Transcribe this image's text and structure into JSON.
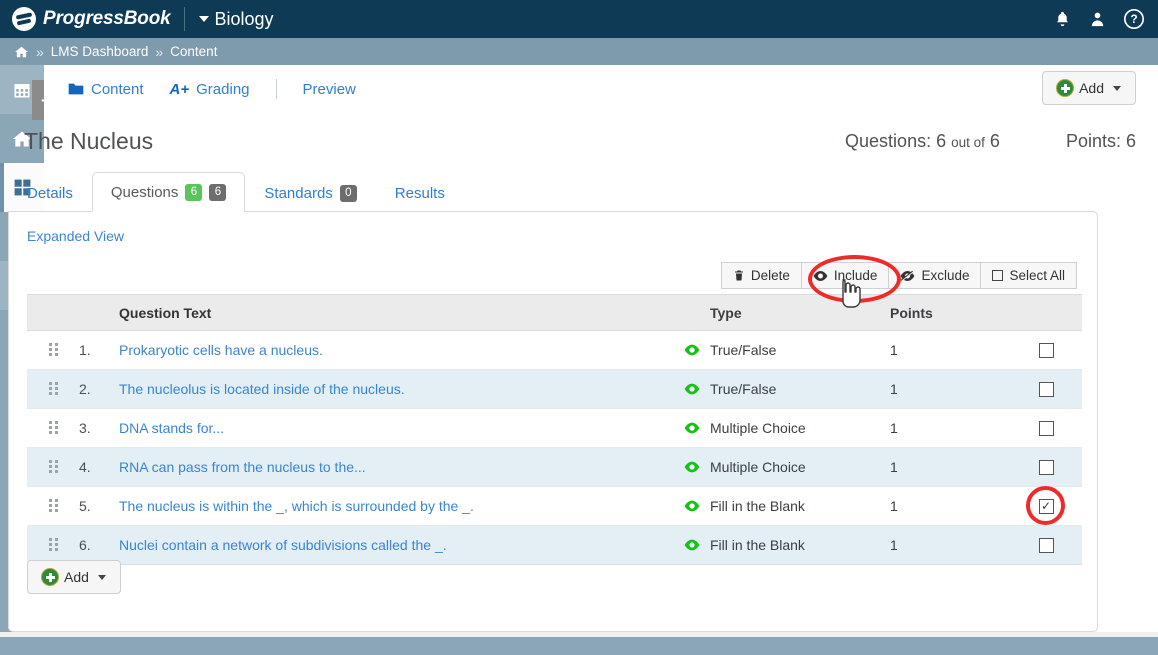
{
  "header": {
    "brand": "ProgressBook",
    "course": "Biology",
    "icons": [
      "bell-icon",
      "user-icon",
      "help-icon"
    ]
  },
  "breadcrumb": {
    "home": "home-icon",
    "separator": "»",
    "items": [
      "LMS Dashboard",
      "Content"
    ]
  },
  "sidebar": {
    "items": [
      {
        "name": "calendar-icon"
      },
      {
        "name": "home-icon"
      },
      {
        "name": "grid-icon"
      },
      {
        "name": "book-icon"
      },
      {
        "name": "link-icon"
      },
      {
        "name": "sitemap-icon"
      },
      {
        "name": "signout-icon"
      }
    ],
    "flyout_label": "+"
  },
  "contentnav": {
    "content": "Content",
    "grading": "Grading",
    "grading_icon": "A+",
    "preview": "Preview",
    "add_label": "Add"
  },
  "title": {
    "name": "The Nucleus",
    "questions_label": "Questions:",
    "questions_count": "6",
    "questions_outof_label": "out of",
    "questions_total": "6",
    "points_label": "Points:",
    "points_value": "6"
  },
  "tabs": [
    {
      "label": "Details",
      "active": false
    },
    {
      "label": "Questions",
      "active": true,
      "badge_green": "6",
      "badge_gray": "6"
    },
    {
      "label": "Standards",
      "active": false,
      "badge_gray": "0"
    },
    {
      "label": "Results",
      "active": false
    }
  ],
  "panel": {
    "expanded_view": "Expanded View",
    "toolbar": [
      {
        "label": "Delete",
        "icon": "trash-icon"
      },
      {
        "label": "Include",
        "icon": "eye-icon"
      },
      {
        "label": "Exclude",
        "icon": "eye-slash-icon"
      },
      {
        "label": "Select All",
        "icon": "checkbox-icon"
      }
    ],
    "columns": {
      "grip": "",
      "num": "",
      "question_text": "Question Text",
      "type": "Type",
      "points": "Points",
      "select": ""
    },
    "rows": [
      {
        "num": "1.",
        "text": "Prokaryotic cells have a nucleus.",
        "type": "True/False",
        "points": "1",
        "checked": false
      },
      {
        "num": "2.",
        "text": "The nucleolus is located inside of the nucleus.",
        "type": "True/False",
        "points": "1",
        "checked": false
      },
      {
        "num": "3.",
        "text": "DNA stands for...",
        "type": "Multiple Choice",
        "points": "1",
        "checked": false
      },
      {
        "num": "4.",
        "text": "RNA can pass from the nucleus to the...",
        "type": "Multiple Choice",
        "points": "1",
        "checked": false
      },
      {
        "num": "5.",
        "text": "The nucleus is within the _, which is surrounded by the _.",
        "type": "Fill in the Blank",
        "points": "1",
        "checked": true
      },
      {
        "num": "6.",
        "text": "Nuclei contain a network of subdivisions called the _.",
        "type": "Fill in the Blank",
        "points": "1",
        "checked": false
      }
    ],
    "add_label": "Add"
  },
  "colors": {
    "header_bg": "#0e3a56",
    "breadcrumb_bg": "#7d9bad",
    "rail_bg": "#8ba6b6",
    "link_blue": "#3b85d0",
    "badge_green": "#5cc45c",
    "badge_gray": "#6d6d6d",
    "annotation_red": "#ee2b2b",
    "eye_green": "#17c217",
    "row_stripe": "#e3eef5"
  }
}
